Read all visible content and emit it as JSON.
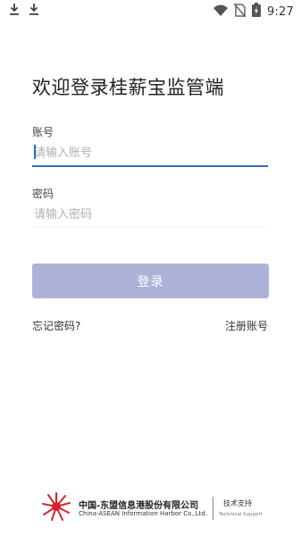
{
  "status_bar": {
    "time": "9:27",
    "left_icons": [
      "download-icon",
      "download-icon"
    ],
    "right_icons": [
      "wifi-icon",
      "no-sim-icon",
      "battery-charging-icon"
    ]
  },
  "title": "欢迎登录桂薪宝监管端",
  "account": {
    "label": "账号",
    "placeholder": "请输入账号",
    "value": ""
  },
  "password": {
    "label": "密码",
    "placeholder": "请输入密码",
    "value": ""
  },
  "login_button": "登录",
  "forgot_password": "忘记密码?",
  "register": "注册账号",
  "footer": {
    "company_cn": "中国-东盟信息港股份有限公司",
    "company_en": "China-ASEAN Information Harbor Co.,Ltd.",
    "support_cn": "技术支持",
    "support_en": "Technical Support"
  },
  "colors": {
    "accent": "#2f6db7",
    "button_bg": "#aeb2d8",
    "logo_red": "#d4232f"
  }
}
